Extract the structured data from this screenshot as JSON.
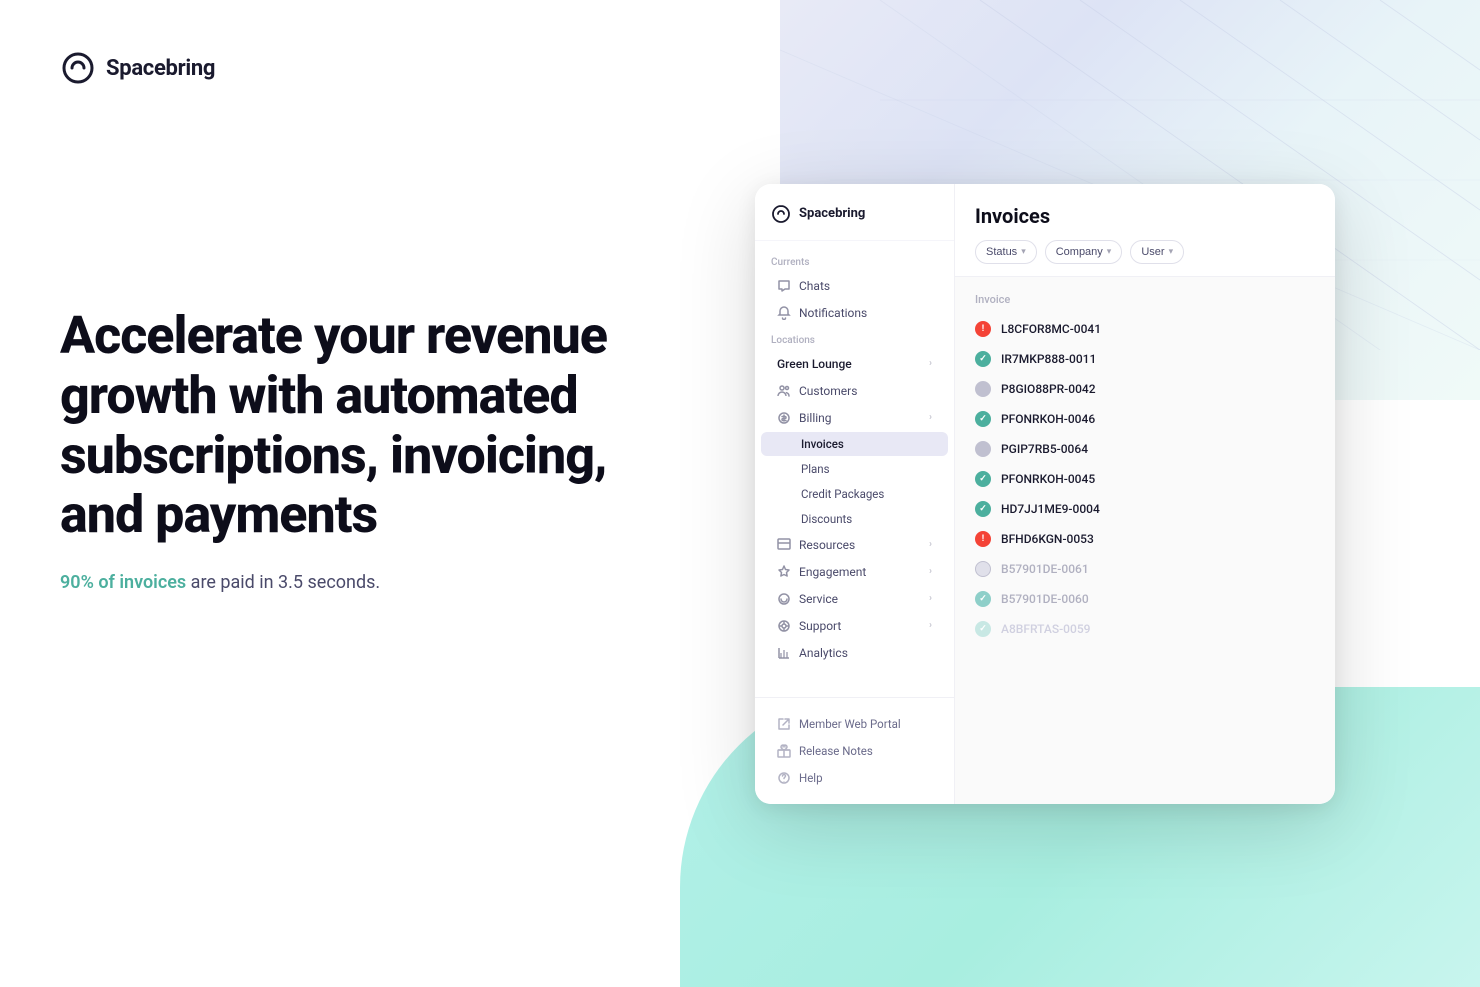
{
  "background": {
    "gradient_top": "top-right decorative gradient",
    "gradient_bottom": "bottom-right teal gradient"
  },
  "logo": {
    "text": "Spacebring"
  },
  "hero": {
    "title": "Accelerate your revenue growth with automated subscriptions, invoicing, and payments",
    "subtitle_prefix": "90% of invoices",
    "subtitle_highlight": "90% of invoices",
    "subtitle_suffix": " are paid in 3.5 seconds.",
    "highlight_text": "90% of invoices",
    "subtitle_plain": " are paid in 3.5 seconds."
  },
  "sidebar": {
    "logo_text": "Spacebring",
    "sections": {
      "currents_label": "Currents",
      "locations_label": "Locations"
    },
    "nav_items": [
      {
        "id": "chats",
        "label": "Chats",
        "icon": "chat"
      },
      {
        "id": "notifications",
        "label": "Notifications",
        "icon": "bell"
      }
    ],
    "location": {
      "name": "Green Lounge",
      "label": "Green Lounge"
    },
    "location_items": [
      {
        "id": "customers",
        "label": "Customers",
        "icon": "users"
      },
      {
        "id": "billing",
        "label": "Billing",
        "icon": "circle",
        "has_chevron": true
      },
      {
        "id": "invoices",
        "label": "Invoices",
        "icon": "list",
        "active": true,
        "sub": true
      },
      {
        "id": "plans",
        "label": "Plans",
        "icon": "grid",
        "sub": true
      },
      {
        "id": "credit-packages",
        "label": "Credit Packages",
        "icon": "package",
        "sub": true
      },
      {
        "id": "discounts",
        "label": "Discounts",
        "icon": "tag",
        "sub": true
      },
      {
        "id": "resources",
        "label": "Resources",
        "icon": "box",
        "has_chevron": true
      },
      {
        "id": "engagement",
        "label": "Engagement",
        "icon": "star",
        "has_chevron": true
      },
      {
        "id": "service",
        "label": "Service",
        "icon": "headset",
        "has_chevron": true
      },
      {
        "id": "support",
        "label": "Support",
        "icon": "help",
        "has_chevron": true
      },
      {
        "id": "analytics",
        "label": "Analytics",
        "icon": "bar-chart"
      }
    ],
    "footer_items": [
      {
        "id": "member-web-portal",
        "label": "Member Web Portal",
        "icon": "external-link"
      },
      {
        "id": "release-notes",
        "label": "Release Notes",
        "icon": "gift"
      },
      {
        "id": "help",
        "label": "Help",
        "icon": "question"
      }
    ]
  },
  "invoices": {
    "title": "Invoices",
    "filters": [
      {
        "id": "status",
        "label": "Status"
      },
      {
        "id": "company",
        "label": "Company"
      },
      {
        "id": "user",
        "label": "User"
      }
    ],
    "column_header": "Invoice",
    "items": [
      {
        "id": "inv1",
        "code": "L8CFOR8MC-0041",
        "status": "error"
      },
      {
        "id": "inv2",
        "code": "IR7MKP888-0011",
        "status": "success"
      },
      {
        "id": "inv3",
        "code": "P8GIO88PR-0042",
        "status": "gray"
      },
      {
        "id": "inv4",
        "code": "PFONRKOH-0046",
        "status": "success"
      },
      {
        "id": "inv5",
        "code": "PGIP7RB5-0064",
        "status": "gray"
      },
      {
        "id": "inv6",
        "code": "PFONRKOH-0045",
        "status": "success"
      },
      {
        "id": "inv7",
        "code": "HD7JJ1ME9-0004",
        "status": "success"
      },
      {
        "id": "inv8",
        "code": "BFHD6KGN-0053",
        "status": "error"
      },
      {
        "id": "inv9",
        "code": "B57901DE-0061",
        "status": "pending",
        "dimmed": true
      },
      {
        "id": "inv10",
        "code": "B57901DE-0060",
        "status": "success-dim",
        "dimmed": true
      },
      {
        "id": "inv11",
        "code": "A8BFRTAS-0059",
        "status": "success-dim",
        "very_dimmed": true
      }
    ]
  }
}
